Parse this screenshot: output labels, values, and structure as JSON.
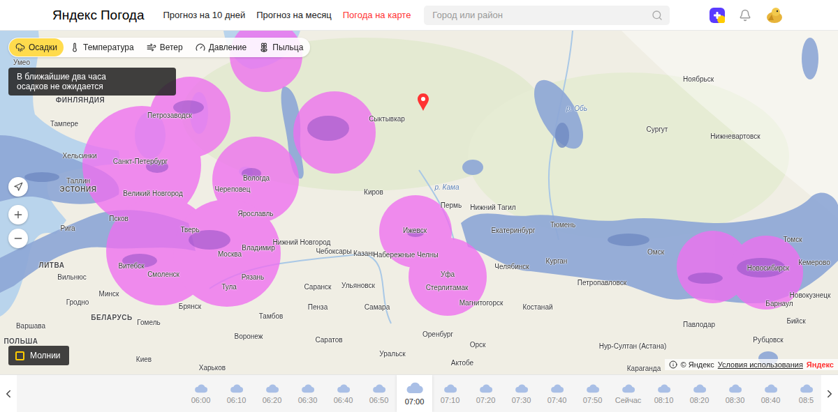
{
  "header": {
    "logo": {
      "brand": "Яндекс",
      "service": "Погода"
    },
    "nav": [
      {
        "label": "Прогноз на 10 дней",
        "selected": false
      },
      {
        "label": "Прогноз на месяц",
        "selected": false
      },
      {
        "label": "Погода на карте",
        "selected": true
      }
    ],
    "search": {
      "placeholder": "Город или район"
    }
  },
  "layers": [
    {
      "label": "Осадки",
      "selected": true
    },
    {
      "label": "Температура",
      "selected": false
    },
    {
      "label": "Ветер",
      "selected": false
    },
    {
      "label": "Давление",
      "selected": false
    },
    {
      "label": "Пыльца",
      "selected": false
    }
  ],
  "notice": "В ближайшие два часа осадков не ожидается",
  "map_labels": [
    {
      "text": "Умео",
      "kind": "city"
    },
    {
      "text": "ФИНЛЯНДИЯ",
      "kind": "country"
    },
    {
      "text": "Тампере",
      "kind": "city"
    },
    {
      "text": "Петрозаводск",
      "kind": "city"
    },
    {
      "text": "Хельсинки",
      "kind": "city"
    },
    {
      "text": "Санкт-Петербург",
      "kind": "city"
    },
    {
      "text": "Таллин",
      "kind": "city"
    },
    {
      "text": "ЭСТОНИЯ",
      "kind": "country"
    },
    {
      "text": "Великий Новгород",
      "kind": "city"
    },
    {
      "text": "Вологда",
      "kind": "city"
    },
    {
      "text": "Череповец",
      "kind": "city"
    },
    {
      "text": "Ярославль",
      "kind": "city"
    },
    {
      "text": "Псков",
      "kind": "city"
    },
    {
      "text": "Рига",
      "kind": "city"
    },
    {
      "text": "Тверь",
      "kind": "city"
    },
    {
      "text": "Нижний Новгород",
      "kind": "city"
    },
    {
      "text": "Владимир",
      "kind": "city"
    },
    {
      "text": "Москва",
      "kind": "city"
    },
    {
      "text": "Чебоксары",
      "kind": "city"
    },
    {
      "text": "Казань",
      "kind": "city"
    },
    {
      "text": "Набережные Челны",
      "kind": "city"
    },
    {
      "text": "Ижевск",
      "kind": "city"
    },
    {
      "text": "Пермь",
      "kind": "city"
    },
    {
      "text": "Киров",
      "kind": "city"
    },
    {
      "text": "Сыктывкар",
      "kind": "city"
    },
    {
      "text": "Нижний Тагил",
      "kind": "city"
    },
    {
      "text": "Екатеринбург",
      "kind": "city"
    },
    {
      "text": "Тюмень",
      "kind": "city"
    },
    {
      "text": "Курган",
      "kind": "city"
    },
    {
      "text": "Челябинск",
      "kind": "city"
    },
    {
      "text": "Омск",
      "kind": "city"
    },
    {
      "text": "Новосибирск",
      "kind": "city"
    },
    {
      "text": "Томск",
      "kind": "city"
    },
    {
      "text": "Кемерово",
      "kind": "city"
    },
    {
      "text": "Новокузнецк",
      "kind": "city"
    },
    {
      "text": "Барнаул",
      "kind": "city"
    },
    {
      "text": "Бийск",
      "kind": "city"
    },
    {
      "text": "Петропавловск",
      "kind": "city"
    },
    {
      "text": "Костанай",
      "kind": "city"
    },
    {
      "text": "Магнитогорск",
      "kind": "city"
    },
    {
      "text": "Уфа",
      "kind": "city"
    },
    {
      "text": "Стерлитамак",
      "kind": "city"
    },
    {
      "text": "Оренбург",
      "kind": "city"
    },
    {
      "text": "Орск",
      "kind": "city"
    },
    {
      "text": "Самара",
      "kind": "city"
    },
    {
      "text": "Ульяновск",
      "kind": "city"
    },
    {
      "text": "Саранск",
      "kind": "city"
    },
    {
      "text": "Пенза",
      "kind": "city"
    },
    {
      "text": "Тамбов",
      "kind": "city"
    },
    {
      "text": "Рязань",
      "kind": "city"
    },
    {
      "text": "Тула",
      "kind": "city"
    },
    {
      "text": "Брянск",
      "kind": "city"
    },
    {
      "text": "Смоленск",
      "kind": "city"
    },
    {
      "text": "Витебск",
      "kind": "city"
    },
    {
      "text": "Минск",
      "kind": "city"
    },
    {
      "text": "ЛИТВА",
      "kind": "country"
    },
    {
      "text": "Вильнюс",
      "kind": "city"
    },
    {
      "text": "Гродно",
      "kind": "city"
    },
    {
      "text": "БЕЛАРУСЬ",
      "kind": "country"
    },
    {
      "text": "Гомель",
      "kind": "city"
    },
    {
      "text": "Варшава",
      "kind": "city"
    },
    {
      "text": "ПОЛЬША",
      "kind": "country"
    },
    {
      "text": "Воронеж",
      "kind": "city"
    },
    {
      "text": "Саратов",
      "kind": "city"
    },
    {
      "text": "Уральск",
      "kind": "city"
    },
    {
      "text": "Актобе",
      "kind": "city"
    },
    {
      "text": "Киев",
      "kind": "city"
    },
    {
      "text": "Харьков",
      "kind": "city"
    },
    {
      "text": "Нур-Султан (Астана)",
      "kind": "city"
    },
    {
      "text": "Караганда",
      "kind": "city"
    },
    {
      "text": "Павлодар",
      "kind": "city"
    },
    {
      "text": "Рубцовск",
      "kind": "city"
    },
    {
      "text": "Сургут",
      "kind": "city"
    },
    {
      "text": "Нижневартовск",
      "kind": "city"
    },
    {
      "text": "Ноябрьск",
      "kind": "city"
    },
    {
      "text": "р. Обь",
      "kind": "river"
    },
    {
      "text": "р. Кама",
      "kind": "river"
    }
  ],
  "lightning": {
    "label": "Молнии",
    "checked": false
  },
  "attribution": {
    "copyright": "© Яндекс",
    "terms": "Условия использования",
    "logo": "Яндекс"
  },
  "timeline": [
    {
      "time": "06:00",
      "selected": false
    },
    {
      "time": "06:10",
      "selected": false
    },
    {
      "time": "06:20",
      "selected": false
    },
    {
      "time": "06:30",
      "selected": false
    },
    {
      "time": "06:40",
      "selected": false
    },
    {
      "time": "06:50",
      "selected": false
    },
    {
      "time": "07:00",
      "selected": true
    },
    {
      "time": "07:10",
      "selected": false
    },
    {
      "time": "07:20",
      "selected": false
    },
    {
      "time": "07:30",
      "selected": false
    },
    {
      "time": "07:40",
      "selected": false
    },
    {
      "time": "07:50",
      "selected": false
    },
    {
      "time": "Сейчас",
      "selected": false
    },
    {
      "time": "08:10",
      "selected": false
    },
    {
      "time": "08:20",
      "selected": false
    },
    {
      "time": "08:30",
      "selected": false
    },
    {
      "time": "08:40",
      "selected": false
    },
    {
      "time": "08:5",
      "selected": false
    }
  ]
}
